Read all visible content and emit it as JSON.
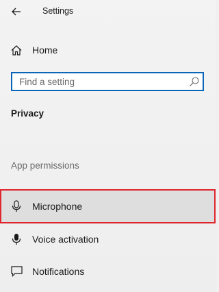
{
  "window": {
    "title": "Settings"
  },
  "nav": {
    "home_label": "Home"
  },
  "search": {
    "placeholder": "Find a setting",
    "value": ""
  },
  "section": {
    "title": "Privacy"
  },
  "app_permissions": {
    "header": "App permissions",
    "items": [
      {
        "label": "Microphone",
        "icon": "microphone-icon",
        "selected": true
      },
      {
        "label": "Voice activation",
        "icon": "voice-activation-icon",
        "selected": false
      },
      {
        "label": "Notifications",
        "icon": "notifications-icon",
        "selected": false
      }
    ]
  },
  "colors": {
    "accent": "#0a64b8",
    "highlight_outline": "#e0242c",
    "selected_background": "#dedede"
  }
}
